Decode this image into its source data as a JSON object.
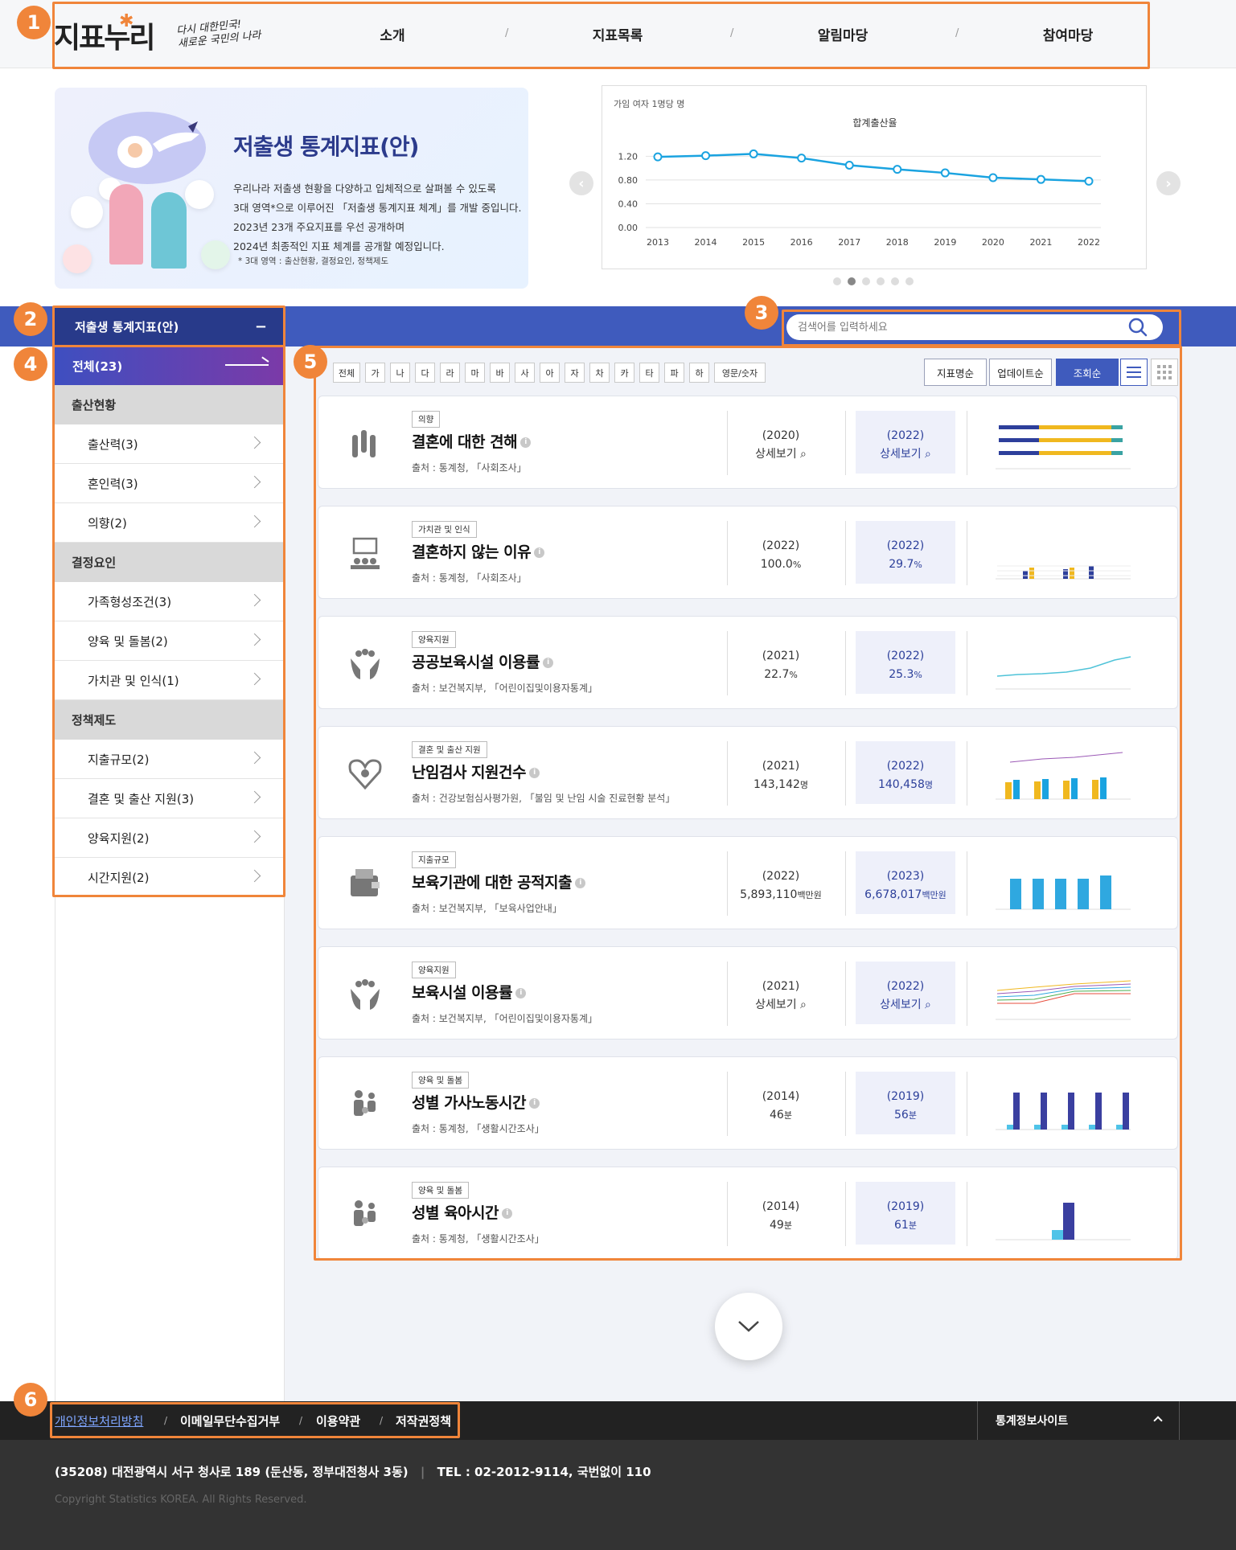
{
  "header": {
    "logo": "지표누리",
    "slogan_line1": "다시 대한민국!",
    "slogan_line2": "새로운 국민의 나라",
    "nav": [
      "소개",
      "지표목록",
      "알림마당",
      "참여마당"
    ],
    "nav_sep": "/"
  },
  "annotations": [
    "1",
    "2",
    "3",
    "4",
    "5",
    "6"
  ],
  "banner": {
    "title": "저출생 통계지표(안)",
    "desc_line1": "우리나라 저출생 현황을 다양하고 입체적으로 살펴볼 수 있도록",
    "desc_line2": "3대 영역*으로 이루어진 「저출생 통계지표 체계」를 개발 중입니다.",
    "desc_line3": "2023년 23개 주요지표를 우선 공개하며",
    "desc_line4": "2024년 최종적인 지표 체계를 공개할 예정입니다.",
    "note": "* 3대 영역 : 출산현황, 결정요인, 정책제도"
  },
  "chart_data": {
    "type": "line",
    "title": "합계출산율",
    "unit_label": "가임 여자 1명당 명",
    "x": [
      "2013",
      "2014",
      "2015",
      "2016",
      "2017",
      "2018",
      "2019",
      "2020",
      "2021",
      "2022"
    ],
    "values": [
      1.19,
      1.21,
      1.24,
      1.17,
      1.05,
      0.98,
      0.92,
      0.84,
      0.81,
      0.78
    ],
    "y_ticks": [
      "0.00",
      "0.40",
      "0.80",
      "1.20"
    ],
    "ylim": [
      0,
      1.3
    ],
    "grid": true,
    "color": "#1aa3e0"
  },
  "carousel": {
    "dot_count": 6,
    "active_index": 1,
    "prev_label": "‹",
    "next_label": "›"
  },
  "category_bar": {
    "title": "저출생 통계지표(안)",
    "toggle": "−"
  },
  "search": {
    "placeholder": "검색어를 입력하세요",
    "icon": "search-icon"
  },
  "sidebar": {
    "all_label": "전체(23)",
    "groups": [
      {
        "label": "출산현황",
        "items": [
          "출산력(3)",
          "혼인력(3)",
          "의향(2)"
        ]
      },
      {
        "label": "결정요인",
        "items": [
          "가족형성조건(3)",
          "양육 및 돌봄(2)",
          "가치관 및 인식(1)"
        ]
      },
      {
        "label": "정책제도",
        "items": [
          "지출규모(2)",
          "결혼 및 출산 지원(3)",
          "양육지원(2)",
          "시간지원(2)"
        ]
      }
    ]
  },
  "filters": {
    "letters": [
      "전체",
      "가",
      "나",
      "다",
      "라",
      "마",
      "바",
      "사",
      "아",
      "자",
      "차",
      "카",
      "타",
      "파",
      "하",
      "영문/숫자"
    ],
    "sort": [
      "지표명순",
      "업데이트순",
      "조회순"
    ],
    "sort_active": "조회순",
    "view_icons": [
      "list-view-icon",
      "grid-view-icon"
    ]
  },
  "cards": [
    {
      "tag": "의향",
      "title": "결혼에 대한 견해",
      "source": "출처 : 통계청, 「사회조사」",
      "year1": "(2020)",
      "val1": "상세보기",
      "unit1": "",
      "year2": "(2022)",
      "val2": "상세보기",
      "unit2": "",
      "icon": "hands-raised-icon",
      "thumb": "stacked"
    },
    {
      "tag": "가치관 및 인식",
      "title": "결혼하지 않는 이유",
      "source": "출처 : 통계청, 「사회조사」",
      "year1": "(2022)",
      "val1": "100.0",
      "unit1": "%",
      "year2": "(2022)",
      "val2": "29.7",
      "unit2": "%",
      "icon": "presentation-icon",
      "thumb": "smallbars"
    },
    {
      "tag": "양육지원",
      "title": "공공보육시설 이용률",
      "source": "출처 : 보건복지부, 「어린이집및이용자통계」",
      "year1": "(2021)",
      "val1": "22.7",
      "unit1": "%",
      "year2": "(2022)",
      "val2": "25.3",
      "unit2": "%",
      "icon": "care-hands-icon",
      "thumb": "line"
    },
    {
      "tag": "결혼 및 출산 지원",
      "title": "난임검사 지원건수",
      "source": "출처 : 건강보험심사평가원, 「불임 및 난임 시술 진료현황 분석」",
      "year1": "(2021)",
      "val1": "143,142",
      "unit1": "명",
      "year2": "(2022)",
      "val2": "140,458",
      "unit2": "명",
      "icon": "heart-baby-icon",
      "thumb": "combo"
    },
    {
      "tag": "지출규모",
      "title": "보육기관에 대한 공적지출",
      "source": "출처 : 보건복지부, 「보육사업안내」",
      "year1": "(2022)",
      "val1": "5,893,110",
      "unit1": "백만원",
      "year2": "(2023)",
      "val2": "6,678,017",
      "unit2": "백만원",
      "icon": "wallet-icon",
      "thumb": "bars"
    },
    {
      "tag": "양육지원",
      "title": "보육시설 이용률",
      "source": "출처 : 보건복지부, 「어린이집및이용자통계」",
      "year1": "(2021)",
      "val1": "상세보기",
      "unit1": "",
      "year2": "(2022)",
      "val2": "상세보기",
      "unit2": "",
      "icon": "care-hands-icon",
      "thumb": "multiline"
    },
    {
      "tag": "양육 및 돌봄",
      "title": "성별 가사노동시간",
      "source": "출처 : 통계청, 「생활시간조사」",
      "year1": "(2014)",
      "val1": "46",
      "unit1": "분",
      "year2": "(2019)",
      "val2": "56",
      "unit2": "분",
      "icon": "family-icon",
      "thumb": "pairbars"
    },
    {
      "tag": "양육 및 돌봄",
      "title": "성별 육아시간",
      "source": "출처 : 통계청, 「생활시간조사」",
      "year1": "(2014)",
      "val1": "49",
      "unit1": "분",
      "year2": "(2019)",
      "val2": "61",
      "unit2": "분",
      "icon": "family-icon",
      "thumb": "singlepair"
    }
  ],
  "footer": {
    "links": [
      "개인정보처리방침",
      "이메일무단수집거부",
      "이용약관",
      "저작권정책"
    ],
    "site_label": "통계정보사이트",
    "address": "(35208) 대전광역시 서구 청사로 189 (둔산동, 정부대전청사 3동)",
    "tel": "TEL : 02-2012-9114, 국번없이 110",
    "copyright": "Copyright Statistics KOREA. All Rights Reserved."
  }
}
